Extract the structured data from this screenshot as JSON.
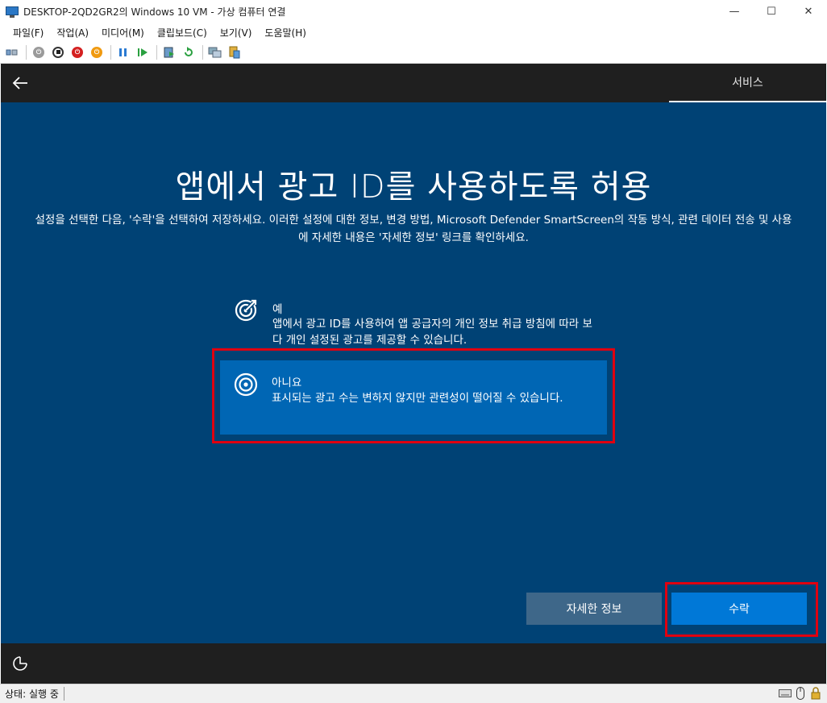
{
  "window": {
    "title": "DESKTOP-2QD2GR2의 Windows 10 VM - 가상 컴퓨터 연결",
    "minimize": "—",
    "maximize": "☐",
    "close": "✕"
  },
  "menu": {
    "items": [
      "파일(F)",
      "작업(A)",
      "미디어(M)",
      "클립보드(C)",
      "보기(V)",
      "도움말(H)"
    ]
  },
  "toolbar": {
    "icons": [
      "ctrl-alt-del-icon",
      "start-icon",
      "turn-off-icon",
      "shut-down-icon",
      "save-state-icon",
      "pause-icon",
      "resume-icon",
      "checkpoint-icon",
      "revert-icon",
      "enhanced-session-icon",
      "share-icon"
    ]
  },
  "vm": {
    "step_label": "서비스",
    "heading": "앱에서 광고 ID를 사용하도록 허용",
    "subtext": "설정을 선택한 다음, '수락'을 선택하여 저장하세요. 이러한 설정에 대한 정보, 변경 방법, Microsoft Defender SmartScreen의 작동 방식, 관련 데이터 전송 및 사용에 자세한 내용은 '자세한 정보' 링크를 확인하세요.",
    "options": [
      {
        "title": "예",
        "description": "앱에서 광고 ID를 사용하여 앱 공급자의 개인 정보 취급 방침에 따라 보다 개인 설정된 광고를 제공할 수 있습니다.",
        "selected": false
      },
      {
        "title": "아니요",
        "description": "표시되는 광고 수는 변하지 않지만 관련성이 떨어질 수 있습니다.",
        "selected": true
      }
    ],
    "buttons": {
      "learn_more": "자세한 정보",
      "accept": "수락"
    },
    "colors": {
      "background": "#004275",
      "selected_option": "#0066b4",
      "accept_button": "#0078d7",
      "learn_more_button": "#3e6789",
      "highlight": "#e00010"
    }
  },
  "status": {
    "text": "상태: 실행 중"
  }
}
